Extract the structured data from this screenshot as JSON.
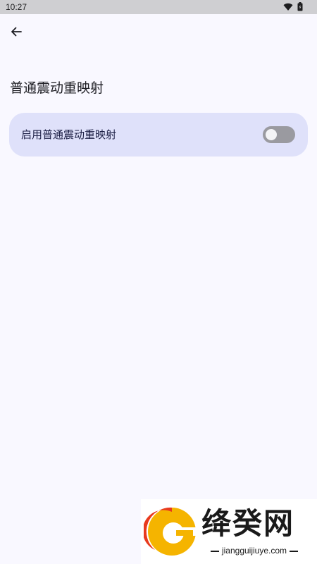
{
  "status_bar": {
    "time": "10:27",
    "icons": [
      "wifi-icon",
      "battery-icon"
    ]
  },
  "header": {
    "back_icon": "arrow-left-icon"
  },
  "page": {
    "title": "普通震动重映射"
  },
  "settings": {
    "enable_remap": {
      "label": "启用普通震动重映射",
      "enabled": false
    }
  },
  "watermark": {
    "brand": "绛癸网",
    "url": "jiangguijiuye.com"
  },
  "colors": {
    "background": "#f9f8ff",
    "card": "#dfe1fa",
    "toggle_off_track": "#9a9aa0",
    "status_bar": "#cfcfd2"
  }
}
